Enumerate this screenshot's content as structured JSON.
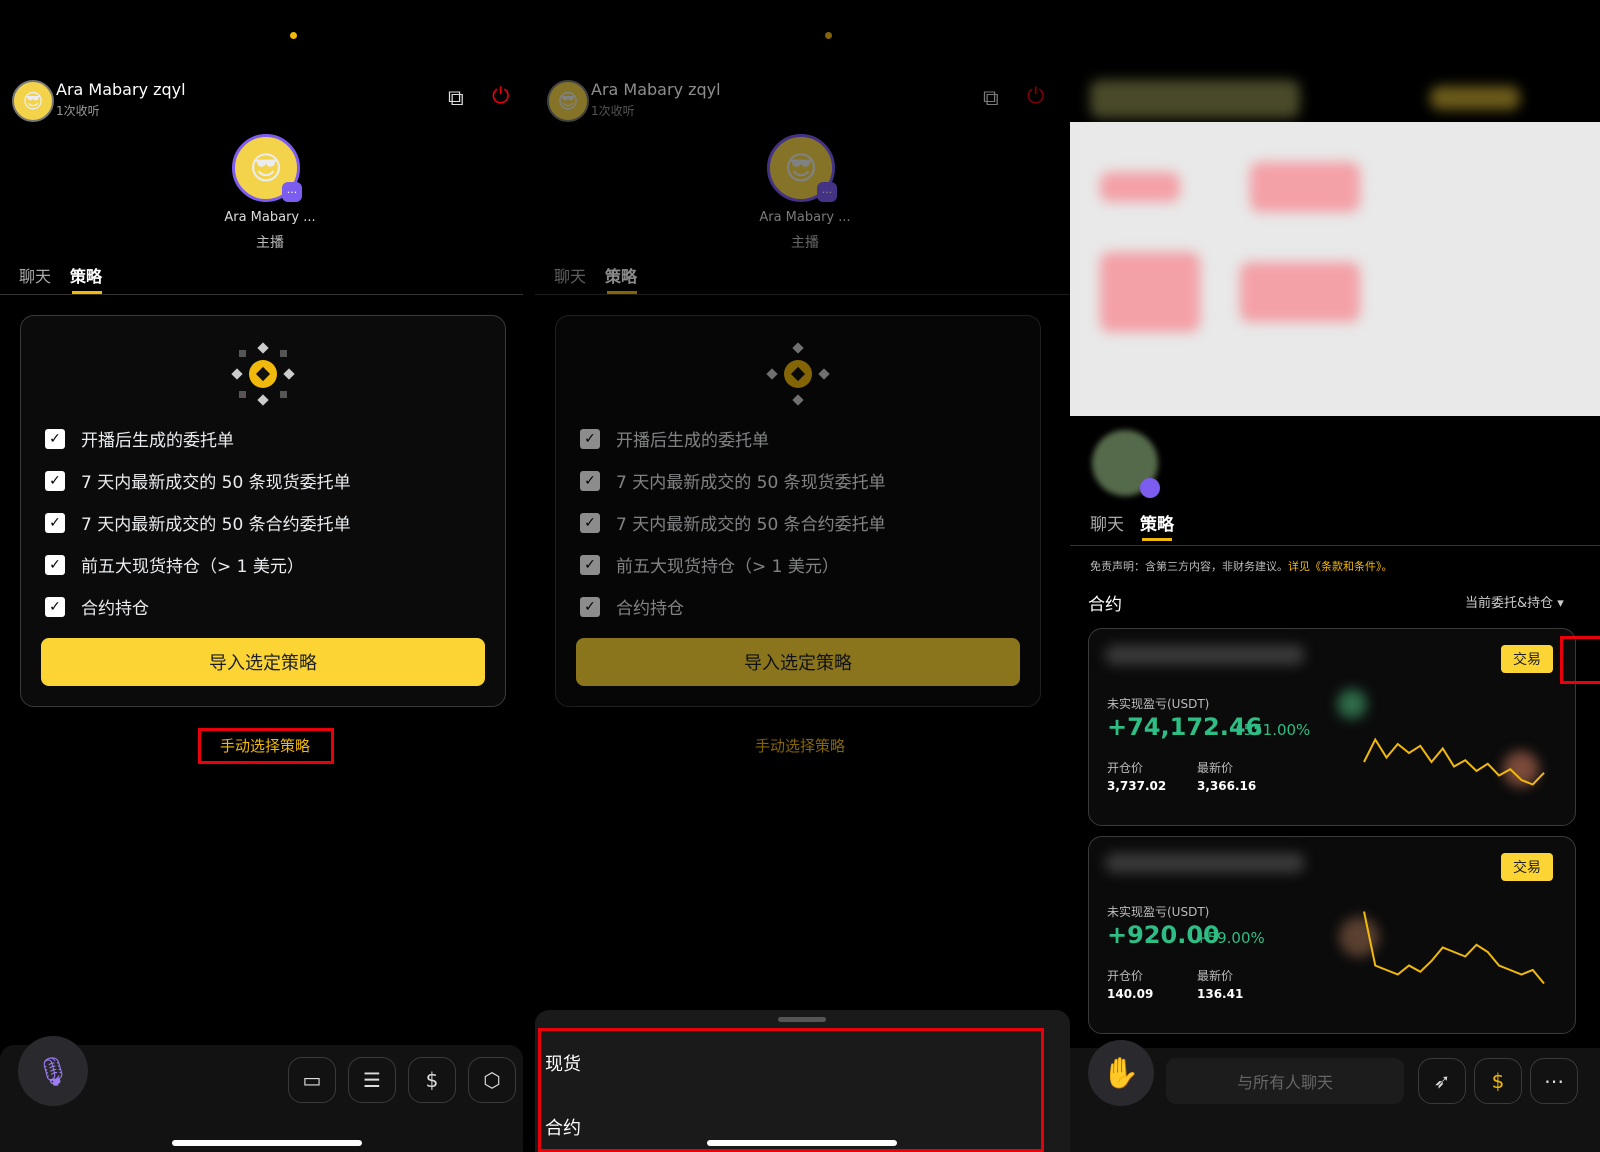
{
  "host": {
    "name": "Ara Mabary zqyl",
    "listen_count": "1次收听",
    "short_name": "Ara Mabary ...",
    "role": "主播",
    "more_badge": "···"
  },
  "tabs": {
    "chat": "聊天",
    "strategy": "策略"
  },
  "strategy_options": [
    "开播后生成的委托单",
    "7 天内最新成交的 50 条现货委托单",
    "7 天内最新成交的 50 条合约委托单",
    "前五大现货持仓（> 1 美元）",
    "合约持仓"
  ],
  "import_button": "导入选定策略",
  "manual_select_link": "手动选择策略",
  "sheet_options": {
    "spot": "现货",
    "futures": "合约"
  },
  "disclaimer": {
    "text": "免责声明：含第三方内容，非财务建议。",
    "link": "详见《条款和条件》。"
  },
  "section": {
    "title": "合约",
    "filter": "当前委托&持仓 ▾"
  },
  "positions": [
    {
      "trade": "交易",
      "pnl_label": "未实现盈亏(USDT)",
      "pnl": "+74,172.46",
      "pnl_pct": "+551.00%",
      "open_label": "开仓价",
      "open": "3,737.02",
      "last_label": "最新价",
      "last": "3,366.16",
      "spark": [
        0.3,
        0.55,
        0.35,
        0.5,
        0.4,
        0.48,
        0.3,
        0.45,
        0.25,
        0.32,
        0.2,
        0.28,
        0.15,
        0.22,
        0.1,
        0.05,
        0.18
      ]
    },
    {
      "trade": "交易",
      "pnl_label": "未实现盈亏(USDT)",
      "pnl": "+920.00",
      "pnl_pct": "+59.00%",
      "open_label": "开仓价",
      "open": "140.09",
      "last_label": "最新价",
      "last": "136.41",
      "spark": [
        0.95,
        0.35,
        0.3,
        0.25,
        0.35,
        0.28,
        0.4,
        0.55,
        0.5,
        0.45,
        0.58,
        0.5,
        0.35,
        0.3,
        0.25,
        0.3,
        0.15
      ]
    }
  ],
  "chat_input_placeholder": "与所有人聊天",
  "toolbar_icons": [
    "chat-icon",
    "users-icon",
    "dollar-icon",
    "box-icon"
  ],
  "colors": {
    "accent": "#f0b90b",
    "positive": "#2ebd85",
    "highlight_red": "#e8000b"
  }
}
